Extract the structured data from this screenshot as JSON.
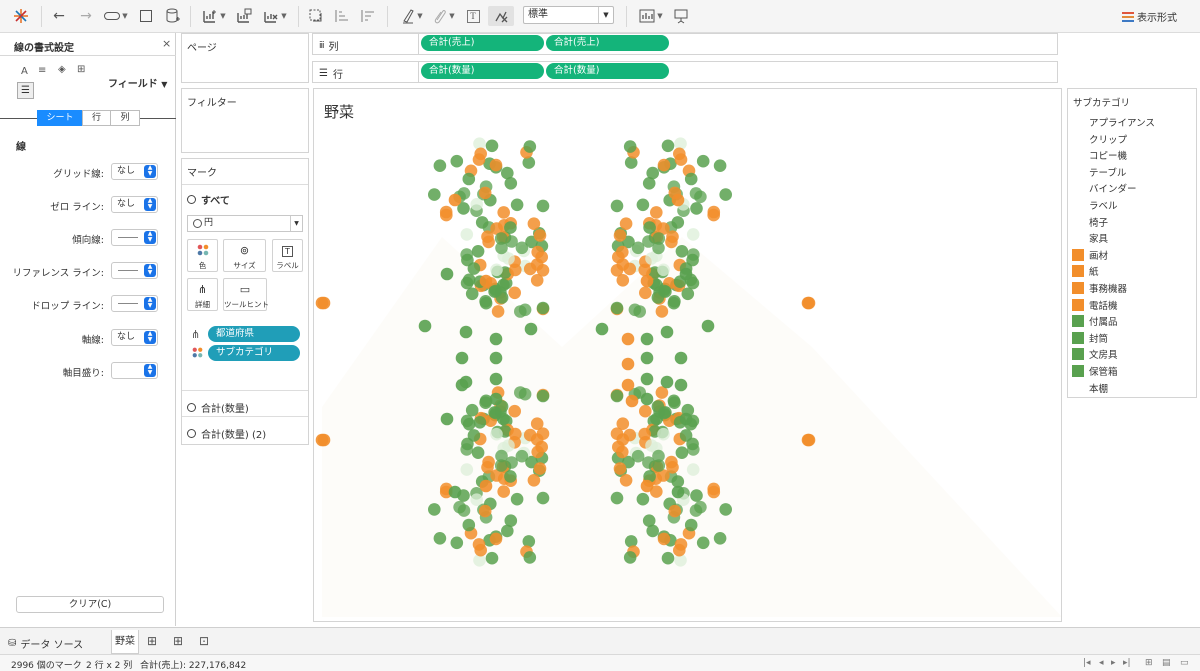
{
  "toolbar": {
    "standard_select": "標準",
    "show_me_label": "表示形式"
  },
  "format_pane": {
    "title": "線の書式設定",
    "close": "×",
    "field_menu": "フィールド",
    "tabs": [
      "シート",
      "行",
      "列"
    ],
    "section": "線",
    "rows": [
      {
        "label": "グリッド線:",
        "value": "なし",
        "kind": "text"
      },
      {
        "label": "ゼロ ライン:",
        "value": "なし",
        "kind": "text"
      },
      {
        "label": "傾向線:",
        "value": "",
        "kind": "line"
      },
      {
        "label": "リファレンス ライン:",
        "value": "",
        "kind": "line"
      },
      {
        "label": "ドロップ ライン:",
        "value": "",
        "kind": "line"
      },
      {
        "label": "軸線:",
        "value": "なし",
        "kind": "text"
      },
      {
        "label": "軸目盛り:",
        "value": "",
        "kind": "blank"
      }
    ],
    "clear_button": "クリア(C)"
  },
  "pages_card": {
    "title": "ページ"
  },
  "filters_card": {
    "title": "フィルター"
  },
  "marks_card": {
    "title": "マーク",
    "all_label": "すべて",
    "mark_type": "円",
    "buttons": [
      "色",
      "サイズ",
      "ラベル",
      "詳細",
      "ツールヒント"
    ],
    "pills": [
      "都道府県",
      "サブカテゴリ"
    ],
    "measure_1": "合計(数量)",
    "measure_2": "合計(数量) (2)"
  },
  "shelves": {
    "columns_label": "列",
    "columns": [
      "合計(売上)",
      "合計(売上)"
    ],
    "rows_label": "行",
    "rows": [
      "合計(数量)",
      "合計(数量)"
    ]
  },
  "view": {
    "title": "野菜"
  },
  "legend": {
    "title": "サブカテゴリ",
    "items": [
      {
        "label": "アプライアンス",
        "color": ""
      },
      {
        "label": "クリップ",
        "color": ""
      },
      {
        "label": "コピー機",
        "color": ""
      },
      {
        "label": "テーブル",
        "color": ""
      },
      {
        "label": "バインダー",
        "color": ""
      },
      {
        "label": "ラベル",
        "color": ""
      },
      {
        "label": "椅子",
        "color": ""
      },
      {
        "label": "家具",
        "color": ""
      },
      {
        "label": "画材",
        "color": "#f28e2b"
      },
      {
        "label": "紙",
        "color": "#f28e2b"
      },
      {
        "label": "事務機器",
        "color": "#f28e2b"
      },
      {
        "label": "電話機",
        "color": "#f28e2b"
      },
      {
        "label": "付属品",
        "color": "#59a14f"
      },
      {
        "label": "封筒",
        "color": "#59a14f"
      },
      {
        "label": "文房具",
        "color": "#59a14f"
      },
      {
        "label": "保管箱",
        "color": "#59a14f"
      },
      {
        "label": "本棚",
        "color": ""
      }
    ]
  },
  "colors": {
    "orange": "#f28e2b",
    "green": "#59a14f",
    "pale": "#dcefd8",
    "pill_green": "#14b47a",
    "pill_blue": "#209eb8"
  },
  "tabs": {
    "data_source": "データ ソース",
    "sheet": "野菜"
  },
  "status": {
    "marks": "2996 個のマーク",
    "dims": "2 行 x 2 列",
    "sum": "合計(売上): 227,176,842"
  }
}
